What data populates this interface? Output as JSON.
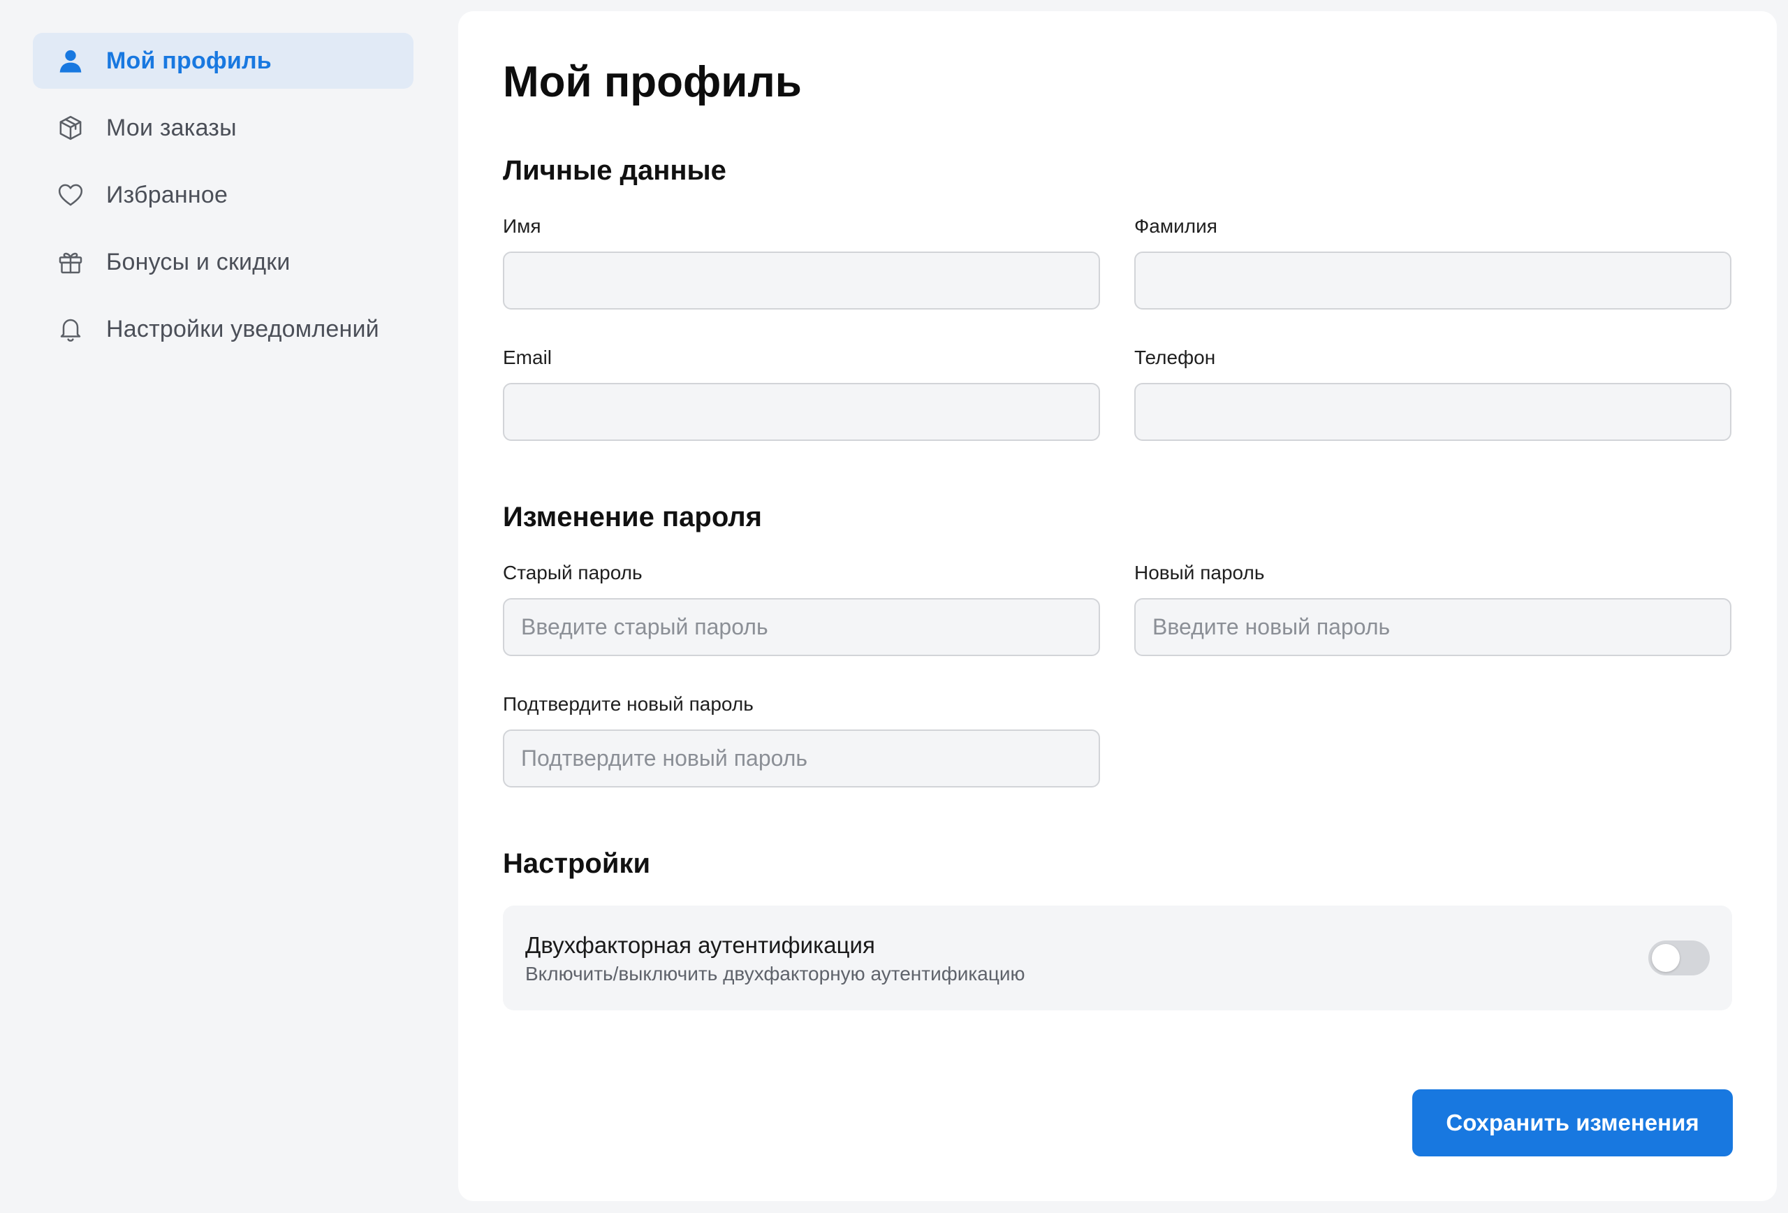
{
  "sidebar": {
    "items": [
      {
        "label": "Мой профиль",
        "icon": "user-icon",
        "active": true
      },
      {
        "label": "Мои заказы",
        "icon": "package-icon",
        "active": false
      },
      {
        "label": "Избранное",
        "icon": "heart-icon",
        "active": false
      },
      {
        "label": "Бонусы и скидки",
        "icon": "gift-icon",
        "active": false
      },
      {
        "label": "Настройки уведомлений",
        "icon": "bell-icon",
        "active": false
      }
    ]
  },
  "main": {
    "title": "Мой профиль",
    "personal": {
      "heading": "Личные данные",
      "first_name": {
        "label": "Имя",
        "value": "",
        "placeholder": ""
      },
      "last_name": {
        "label": "Фамилия",
        "value": "",
        "placeholder": ""
      },
      "email": {
        "label": "Email",
        "value": "",
        "placeholder": ""
      },
      "phone": {
        "label": "Телефон",
        "value": "",
        "placeholder": ""
      }
    },
    "password": {
      "heading": "Изменение пароля",
      "old": {
        "label": "Старый пароль",
        "placeholder": "Введите старый пароль"
      },
      "new": {
        "label": "Новый пароль",
        "placeholder": "Введите новый пароль"
      },
      "confirm": {
        "label": "Подтвердите новый пароль",
        "placeholder": "Подтвердите новый пароль"
      }
    },
    "settings": {
      "heading": "Настройки",
      "two_factor": {
        "title": "Двухфакторная аутентификация",
        "description": "Включить/выключить двухфакторную аутентификацию",
        "enabled": false
      }
    },
    "save_label": "Сохранить изменения"
  },
  "colors": {
    "accent": "#1878e0",
    "active_nav_bg": "#e1eaf6",
    "page_bg": "#f4f5f7"
  }
}
